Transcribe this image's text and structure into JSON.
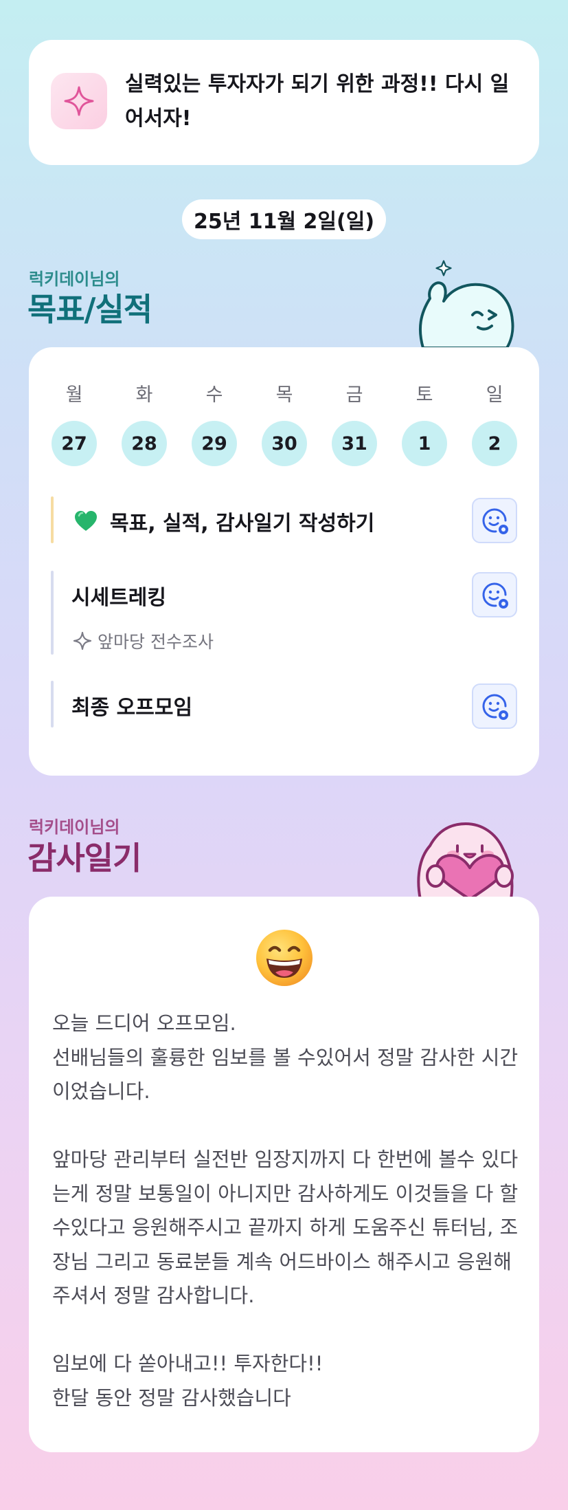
{
  "motto": {
    "text": "실력있는 투자자가 되기 위한 과정!! 다시 일어서자!"
  },
  "date": "25년 11월 2일(일)",
  "goals_section": {
    "subtitle": "럭키데이님의",
    "title": "목표/실적"
  },
  "week": {
    "days": [
      "월",
      "화",
      "수",
      "목",
      "금",
      "토",
      "일"
    ],
    "dates": [
      "27",
      "28",
      "29",
      "30",
      "31",
      "1",
      "2"
    ]
  },
  "tasks": [
    {
      "title": "목표, 실적, 감사일기 작성하기",
      "icon": "green-heart-icon",
      "bar_color": "#f6dca2"
    },
    {
      "title": "시세트레킹",
      "subtitle": "앞마당 전수조사",
      "bar_color": "#d7dcef"
    },
    {
      "title": "최종 오프모임",
      "bar_color": "#d7dcef"
    }
  ],
  "diary_section": {
    "subtitle": "럭키데이님의",
    "title": "감사일기"
  },
  "diary": {
    "emoji": "grinning-face-icon",
    "p1": "오늘 드디어 오프모임.\n선배님들의 훌륭한 임보를 볼 수있어서 정말 감사한 시간이었습니다.",
    "p2": "앞마당 관리부터 실전반 임장지까지 다 한번에 볼수 있다는게 정말 보통일이 아니지만 감사하게도 이것들을 다 할수있다고 응원해주시고 끝까지 하게 도움주신 튜터님, 조장님 그리고 동료분들 계속 어드바이스 해주시고 응원해주셔서 정말 감사합니다.",
    "p3": "임보에 다 쏟아내고!! 투자한다!!\n한달 동안 정말 감사했습니다"
  },
  "colors": {
    "teal": "#10707a",
    "pink": "#8a2c6a",
    "day_circle": "#c7f0f3",
    "emotion_button": "#eef3ff",
    "emotion_icon": "#3563e9"
  }
}
